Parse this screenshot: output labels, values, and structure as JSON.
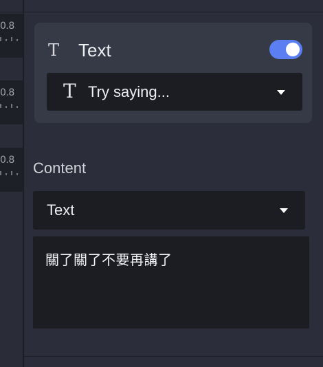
{
  "timeline": {
    "track_values": [
      "0.8",
      "0.8",
      "0.8"
    ]
  },
  "text_card": {
    "icon": "text-format-icon",
    "title": "Text",
    "toggle_on": true,
    "accent_color": "#5b7ef2",
    "voice_dropdown": {
      "icon": "text-format-icon",
      "value": "Try saying..."
    }
  },
  "content_section": {
    "label": "Content",
    "type_dropdown": {
      "value": "Text"
    },
    "textarea_value": "關了關了不要再講了"
  }
}
